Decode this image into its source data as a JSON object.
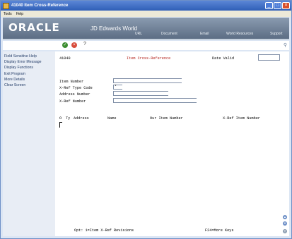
{
  "window": {
    "title": "41040   Item Cross-Reference"
  },
  "menubar": {
    "items": [
      "Tools",
      "Help"
    ]
  },
  "header": {
    "logo": "ORACLE",
    "logo_sub": "JD Edwards World",
    "nav": [
      "URL",
      "Document",
      "Email",
      "World Resources",
      "Support"
    ]
  },
  "toolbar": {
    "help_glyph": "?"
  },
  "sidebar": {
    "items": [
      "Field Sensitive Help",
      "Display Error Message",
      "Display Functions",
      "Exit Program",
      "More Details",
      "Clear Screen"
    ]
  },
  "form": {
    "program_id": "41040",
    "title": "Item Cross-Reference",
    "date_valid_label": "Date Valid",
    "date_valid_value": "",
    "fields": [
      {
        "label": "Item Number",
        "value": ""
      },
      {
        "label": "X-Ref Type Code",
        "value": "*"
      },
      {
        "label": "Address Number",
        "value": ""
      },
      {
        "label": "X-Ref Number",
        "value": ""
      }
    ],
    "grid_headers": {
      "o": "O",
      "ty": "Ty",
      "address": "Address",
      "name": "Name",
      "our_item": "Our Item Number",
      "xref_item": "X-Ref Item Number"
    },
    "footer_options": "Opt:  1=Item X-Ref Revisions",
    "footer_keys": "F24=More Keys"
  }
}
